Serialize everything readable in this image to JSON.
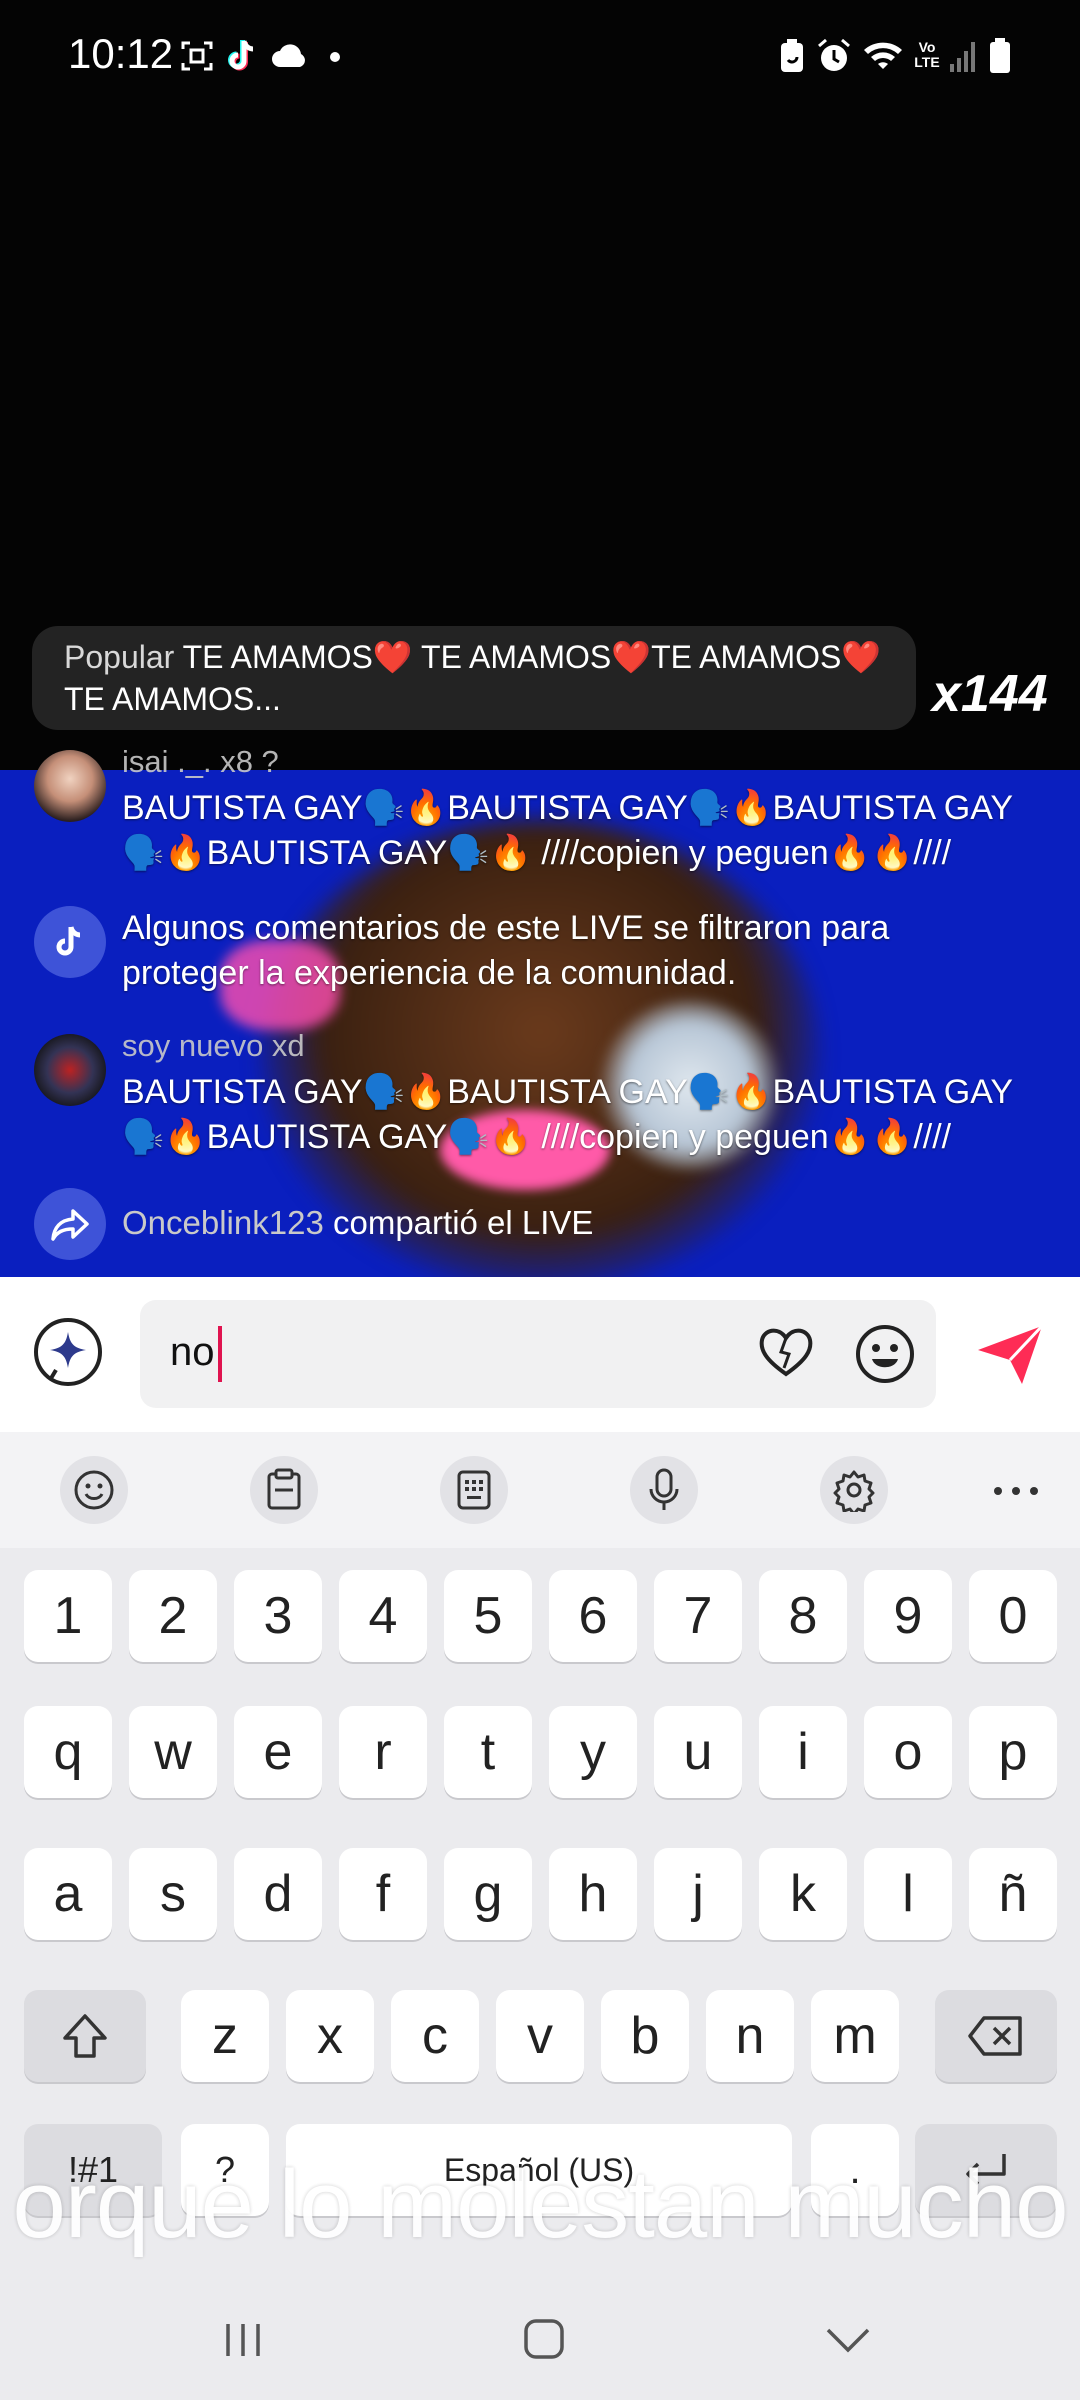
{
  "status_bar": {
    "time": "10:12",
    "left_icons": [
      "screenshot-icon",
      "tiktok-icon",
      "cloud-icon",
      "dot-icon"
    ],
    "right_icons": [
      "battery-saver-icon",
      "alarm-icon",
      "wifi-icon",
      "volte-icon",
      "signal-icon",
      "battery-icon"
    ],
    "volte_label": "Vo LTE"
  },
  "live": {
    "popular": {
      "label": "Popular",
      "text": "TE AMAMOS❤️ TE AMAMOS❤️TE AMAMOS❤️ TE AMAMOS...",
      "multiplier": "x144"
    },
    "comments": [
      {
        "user": "isai ._. x8 ?",
        "text": "BAUTISTA GAY🗣️🔥BAUTISTA GAY🗣️🔥BAUTISTA GAY 🗣️🔥BAUTISTA GAY🗣️🔥      ////copien y peguen🔥🔥////"
      },
      {
        "user": "",
        "text": "Algunos comentarios de este LIVE se filtraron para proteger la experiencia de la comunidad."
      },
      {
        "user": "soy nuevo xd",
        "text": "BAUTISTA GAY🗣️🔥BAUTISTA GAY🗣️🔥BAUTISTA GAY 🗣️🔥BAUTISTA GAY🗣️🔥      ////copien y peguen🔥🔥////"
      }
    ],
    "share_notice": {
      "user": "Onceblink123",
      "text": "compartió el LIVE"
    }
  },
  "comment_bar": {
    "input_value": "no"
  },
  "keyboard": {
    "toolbar": [
      "emoji-icon",
      "clipboard-icon",
      "keypad-icon",
      "microphone-icon",
      "settings-icon",
      "more-icon"
    ],
    "row_numbers": [
      "1",
      "2",
      "3",
      "4",
      "5",
      "6",
      "7",
      "8",
      "9",
      "0"
    ],
    "row_1": [
      "q",
      "w",
      "e",
      "r",
      "t",
      "y",
      "u",
      "i",
      "o",
      "p"
    ],
    "row_2": [
      "a",
      "s",
      "d",
      "f",
      "g",
      "h",
      "j",
      "k",
      "l",
      "ñ"
    ],
    "row_3": [
      "z",
      "x",
      "c",
      "v",
      "b",
      "n",
      "m"
    ],
    "symbols_key": "!#1",
    "question_key": "?",
    "space_label": "Español (US)",
    "period_key": "."
  },
  "subtitle": "orque lo molestan mucho",
  "colors": {
    "tiktok_blue": "#3e53d8",
    "send_red": "#fe2c55",
    "caret": "#e0134f",
    "keyboard_bg": "#ebebee"
  }
}
